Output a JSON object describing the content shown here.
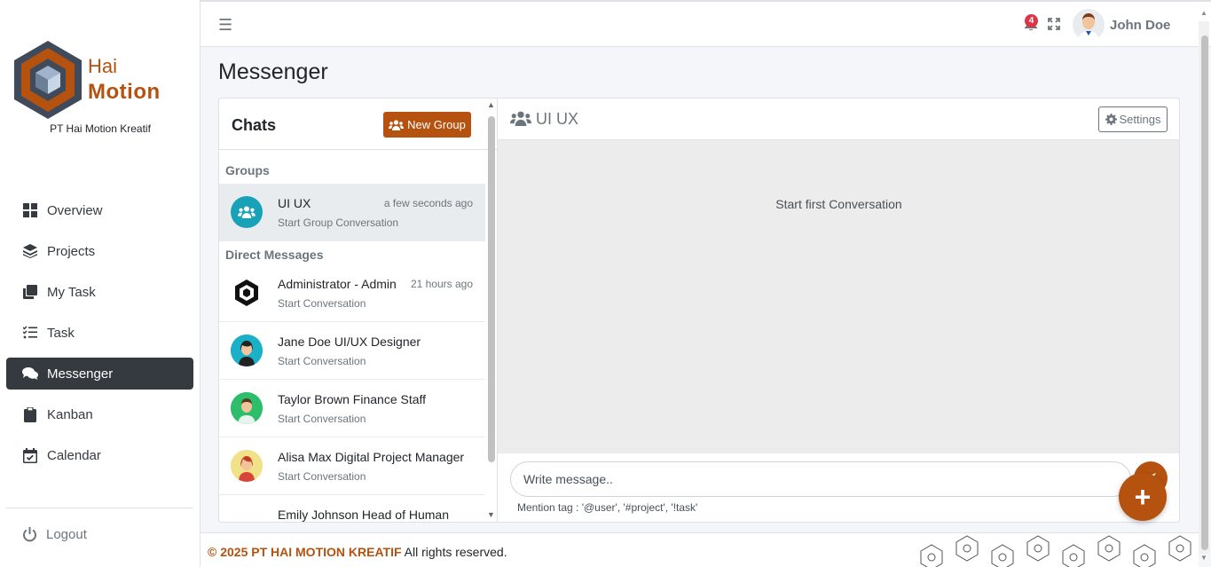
{
  "brand": {
    "name_line1": "Hai",
    "name_line2": "Motion",
    "company": "PT Hai Motion Kreatif",
    "colors": {
      "accent": "#b5520f",
      "dark": "#343a40"
    }
  },
  "sidebar": {
    "items": [
      {
        "label": "Overview",
        "icon": "grid-icon",
        "active": false
      },
      {
        "label": "Projects",
        "icon": "layers-icon",
        "active": false
      },
      {
        "label": "My Task",
        "icon": "copy-icon",
        "active": false
      },
      {
        "label": "Task",
        "icon": "list-check-icon",
        "active": false
      },
      {
        "label": "Messenger",
        "icon": "comments-icon",
        "active": true
      },
      {
        "label": "Kanban",
        "icon": "clipboard-icon",
        "active": false
      },
      {
        "label": "Calendar",
        "icon": "calendar-check-icon",
        "active": false
      }
    ],
    "logout_label": "Logout"
  },
  "topbar": {
    "notification_count": "4",
    "user_name": "John Doe"
  },
  "page": {
    "title": "Messenger"
  },
  "chats": {
    "title": "Chats",
    "new_group_label": "New Group",
    "groups_label": "Groups",
    "direct_label": "Direct Messages",
    "groups": [
      {
        "name": "UI UX",
        "time": "a few seconds ago",
        "subtitle": "Start Group Conversation"
      }
    ],
    "direct": [
      {
        "name": "Administrator - Admin",
        "time": "21 hours ago",
        "subtitle": "Start Conversation"
      },
      {
        "name": "Jane Doe UI/UX Designer",
        "time": "",
        "subtitle": "Start Conversation"
      },
      {
        "name": "Taylor Brown Finance Staff",
        "time": "",
        "subtitle": "Start Conversation"
      },
      {
        "name": "Alisa Max Digital Project Manager",
        "time": "",
        "subtitle": "Start Conversation"
      },
      {
        "name": "Emily Johnson Head of Human",
        "time": "",
        "subtitle": ""
      }
    ]
  },
  "conversation": {
    "title": "UI UX",
    "settings_label": "Settings",
    "empty_text": "Start first Conversation",
    "composer_placeholder": "Write message..",
    "mention_tip": "Mention tag : '@user', '#project', '!task'"
  },
  "footer": {
    "brand": "© 2025 PT HAI MOTION KREATIF",
    "rights": " All rights reserved."
  }
}
